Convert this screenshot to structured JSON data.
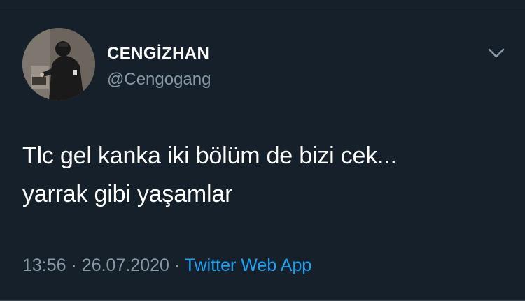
{
  "tweet": {
    "display_name": "CENGİZHAN",
    "handle": "@Cengogang",
    "text_lines": [
      "Tlc gel kanka iki bölüm de bizi cek...",
      "yarrak gibi yaşamlar"
    ],
    "time": "13:56",
    "separator": "·",
    "date": "26.07.2020",
    "source": "Twitter Web App"
  },
  "icons": {
    "menu": "chevron-down-icon"
  },
  "colors": {
    "background": "#15202b",
    "primary_text": "#ffffff",
    "secondary_text": "#8899a6",
    "link": "#1da1f2",
    "divider": "#38444d"
  }
}
